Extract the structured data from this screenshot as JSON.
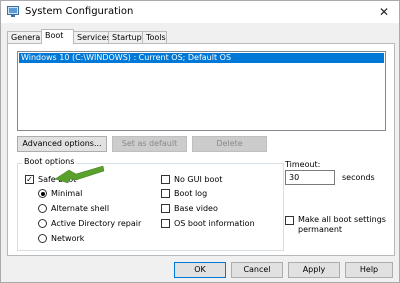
{
  "window": {
    "title": "System Configuration",
    "close_glyph": "✕"
  },
  "tabs": [
    {
      "label": "General",
      "active": false
    },
    {
      "label": "Boot",
      "active": true
    },
    {
      "label": "Services",
      "active": false
    },
    {
      "label": "Startup",
      "active": false
    },
    {
      "label": "Tools",
      "active": false
    }
  ],
  "os_list": {
    "items": [
      "Windows 10 (C:\\WINDOWS) : Current OS; Default OS"
    ],
    "selected_index": 0
  },
  "buttons": {
    "advanced": "Advanced options...",
    "set_default": "Set as default",
    "delete": "Delete",
    "ok": "OK",
    "cancel": "Cancel",
    "apply": "Apply",
    "help": "Help"
  },
  "boot_options": {
    "label": "Boot options",
    "safe_boot": {
      "label": "Safe boot",
      "checked": true
    },
    "minimal": {
      "label": "Minimal",
      "selected": true
    },
    "alternate_shell": {
      "label": "Alternate shell",
      "selected": false
    },
    "ad_repair": {
      "label": "Active Directory repair",
      "selected": false
    },
    "network": {
      "label": "Network",
      "selected": false
    },
    "no_gui": {
      "label": "No GUI boot",
      "checked": false
    },
    "boot_log": {
      "label": "Boot log",
      "checked": false
    },
    "base_video": {
      "label": "Base video",
      "checked": false
    },
    "os_boot_info": {
      "label": "OS boot information",
      "checked": false
    }
  },
  "timeout": {
    "label": "Timeout:",
    "value": "30",
    "unit": "seconds"
  },
  "permanent": {
    "label": "Make all boot settings permanent",
    "checked": false
  },
  "colors": {
    "selection": "#0078d7",
    "arrow": "#5aa02c"
  },
  "icons": {
    "title": "msconfig-icon",
    "close": "close-icon",
    "check": "checkmark-icon",
    "annotation": "green-arrow-icon"
  }
}
